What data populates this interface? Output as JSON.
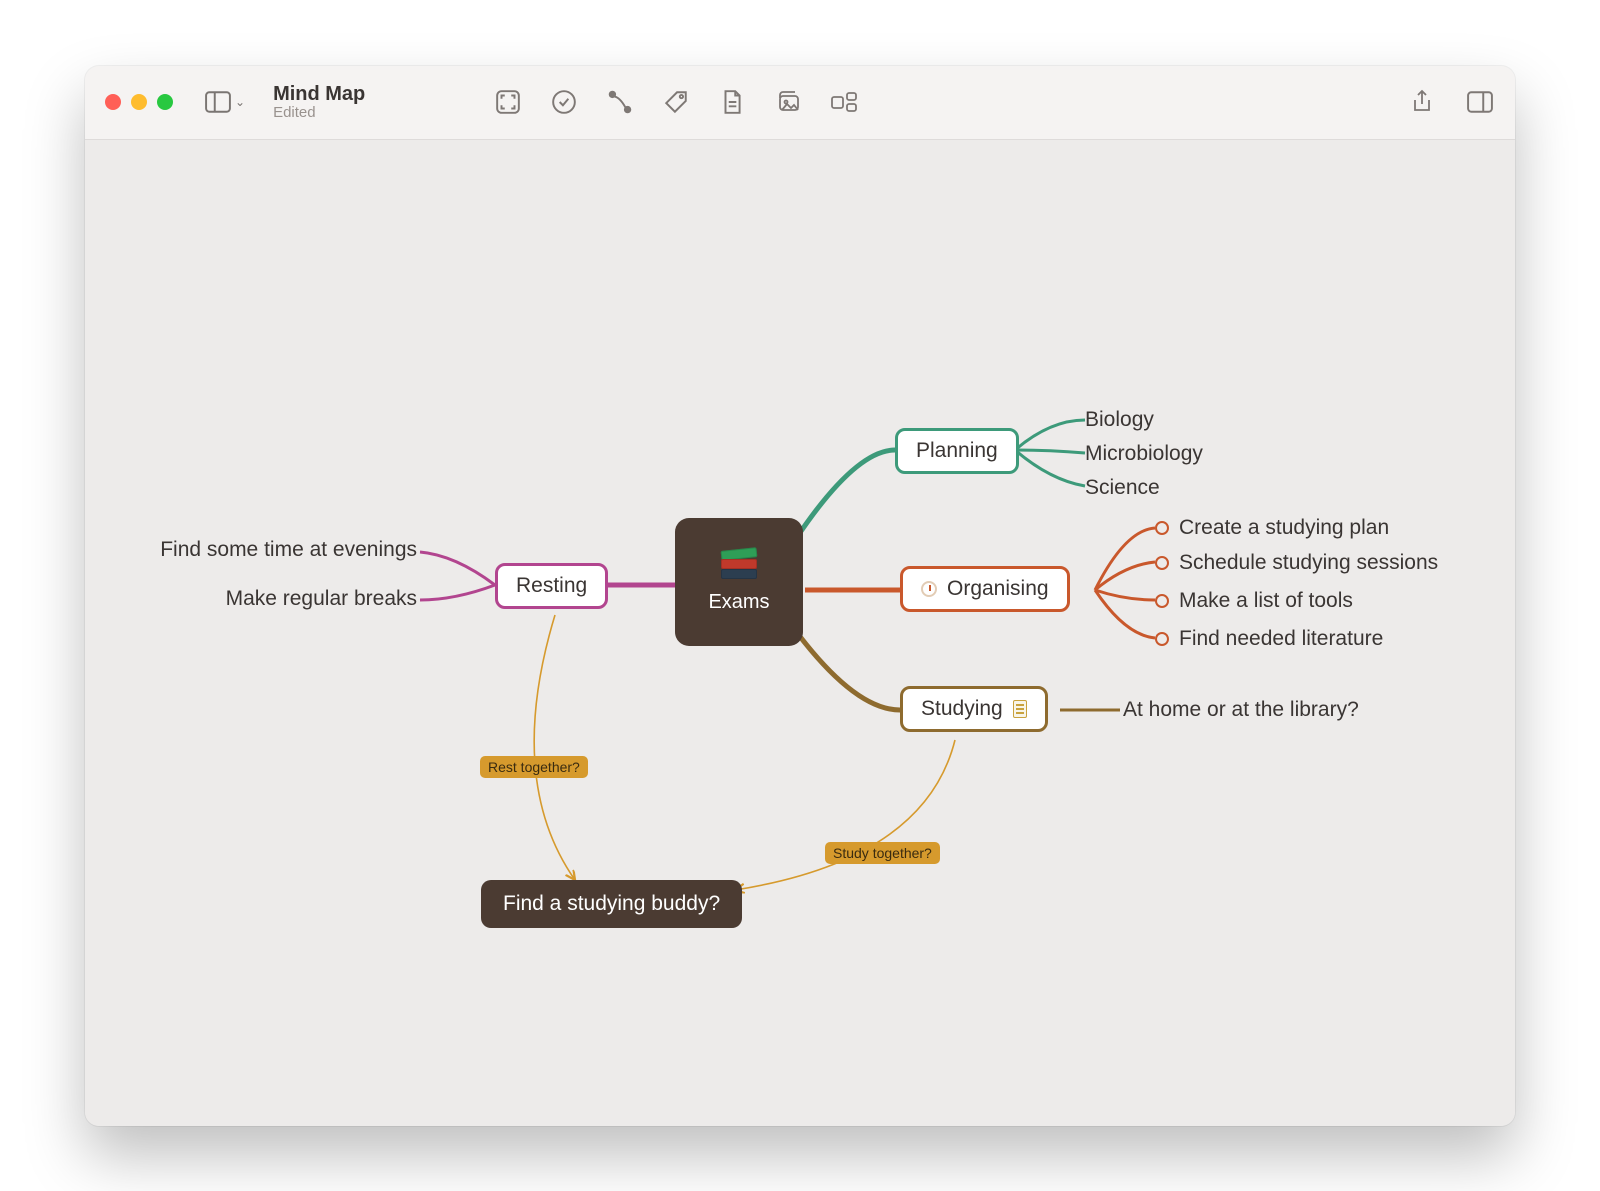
{
  "window": {
    "title": "Mind Map",
    "subtitle": "Edited"
  },
  "mindmap": {
    "center": "Exams",
    "branches": {
      "planning": {
        "label": "Planning",
        "color": "#3d9a7a",
        "children": [
          "Biology",
          "Microbiology",
          "Science"
        ]
      },
      "organising": {
        "label": "Organising",
        "color": "#c9582c",
        "children": [
          "Create a studying plan",
          "Schedule studying sessions",
          "Make a list of tools",
          "Find needed literature"
        ]
      },
      "studying": {
        "label": "Studying",
        "color": "#8e6b2f",
        "children": [
          "At home or at the library?"
        ]
      },
      "resting": {
        "label": "Resting",
        "color": "#b2458f",
        "children": [
          "Find some time at evenings",
          "Make regular breaks"
        ]
      }
    },
    "floating": {
      "buddy": "Find a studying buddy?"
    },
    "crosslinks": {
      "rest_together": "Rest together?",
      "study_together": "Study together?"
    }
  }
}
